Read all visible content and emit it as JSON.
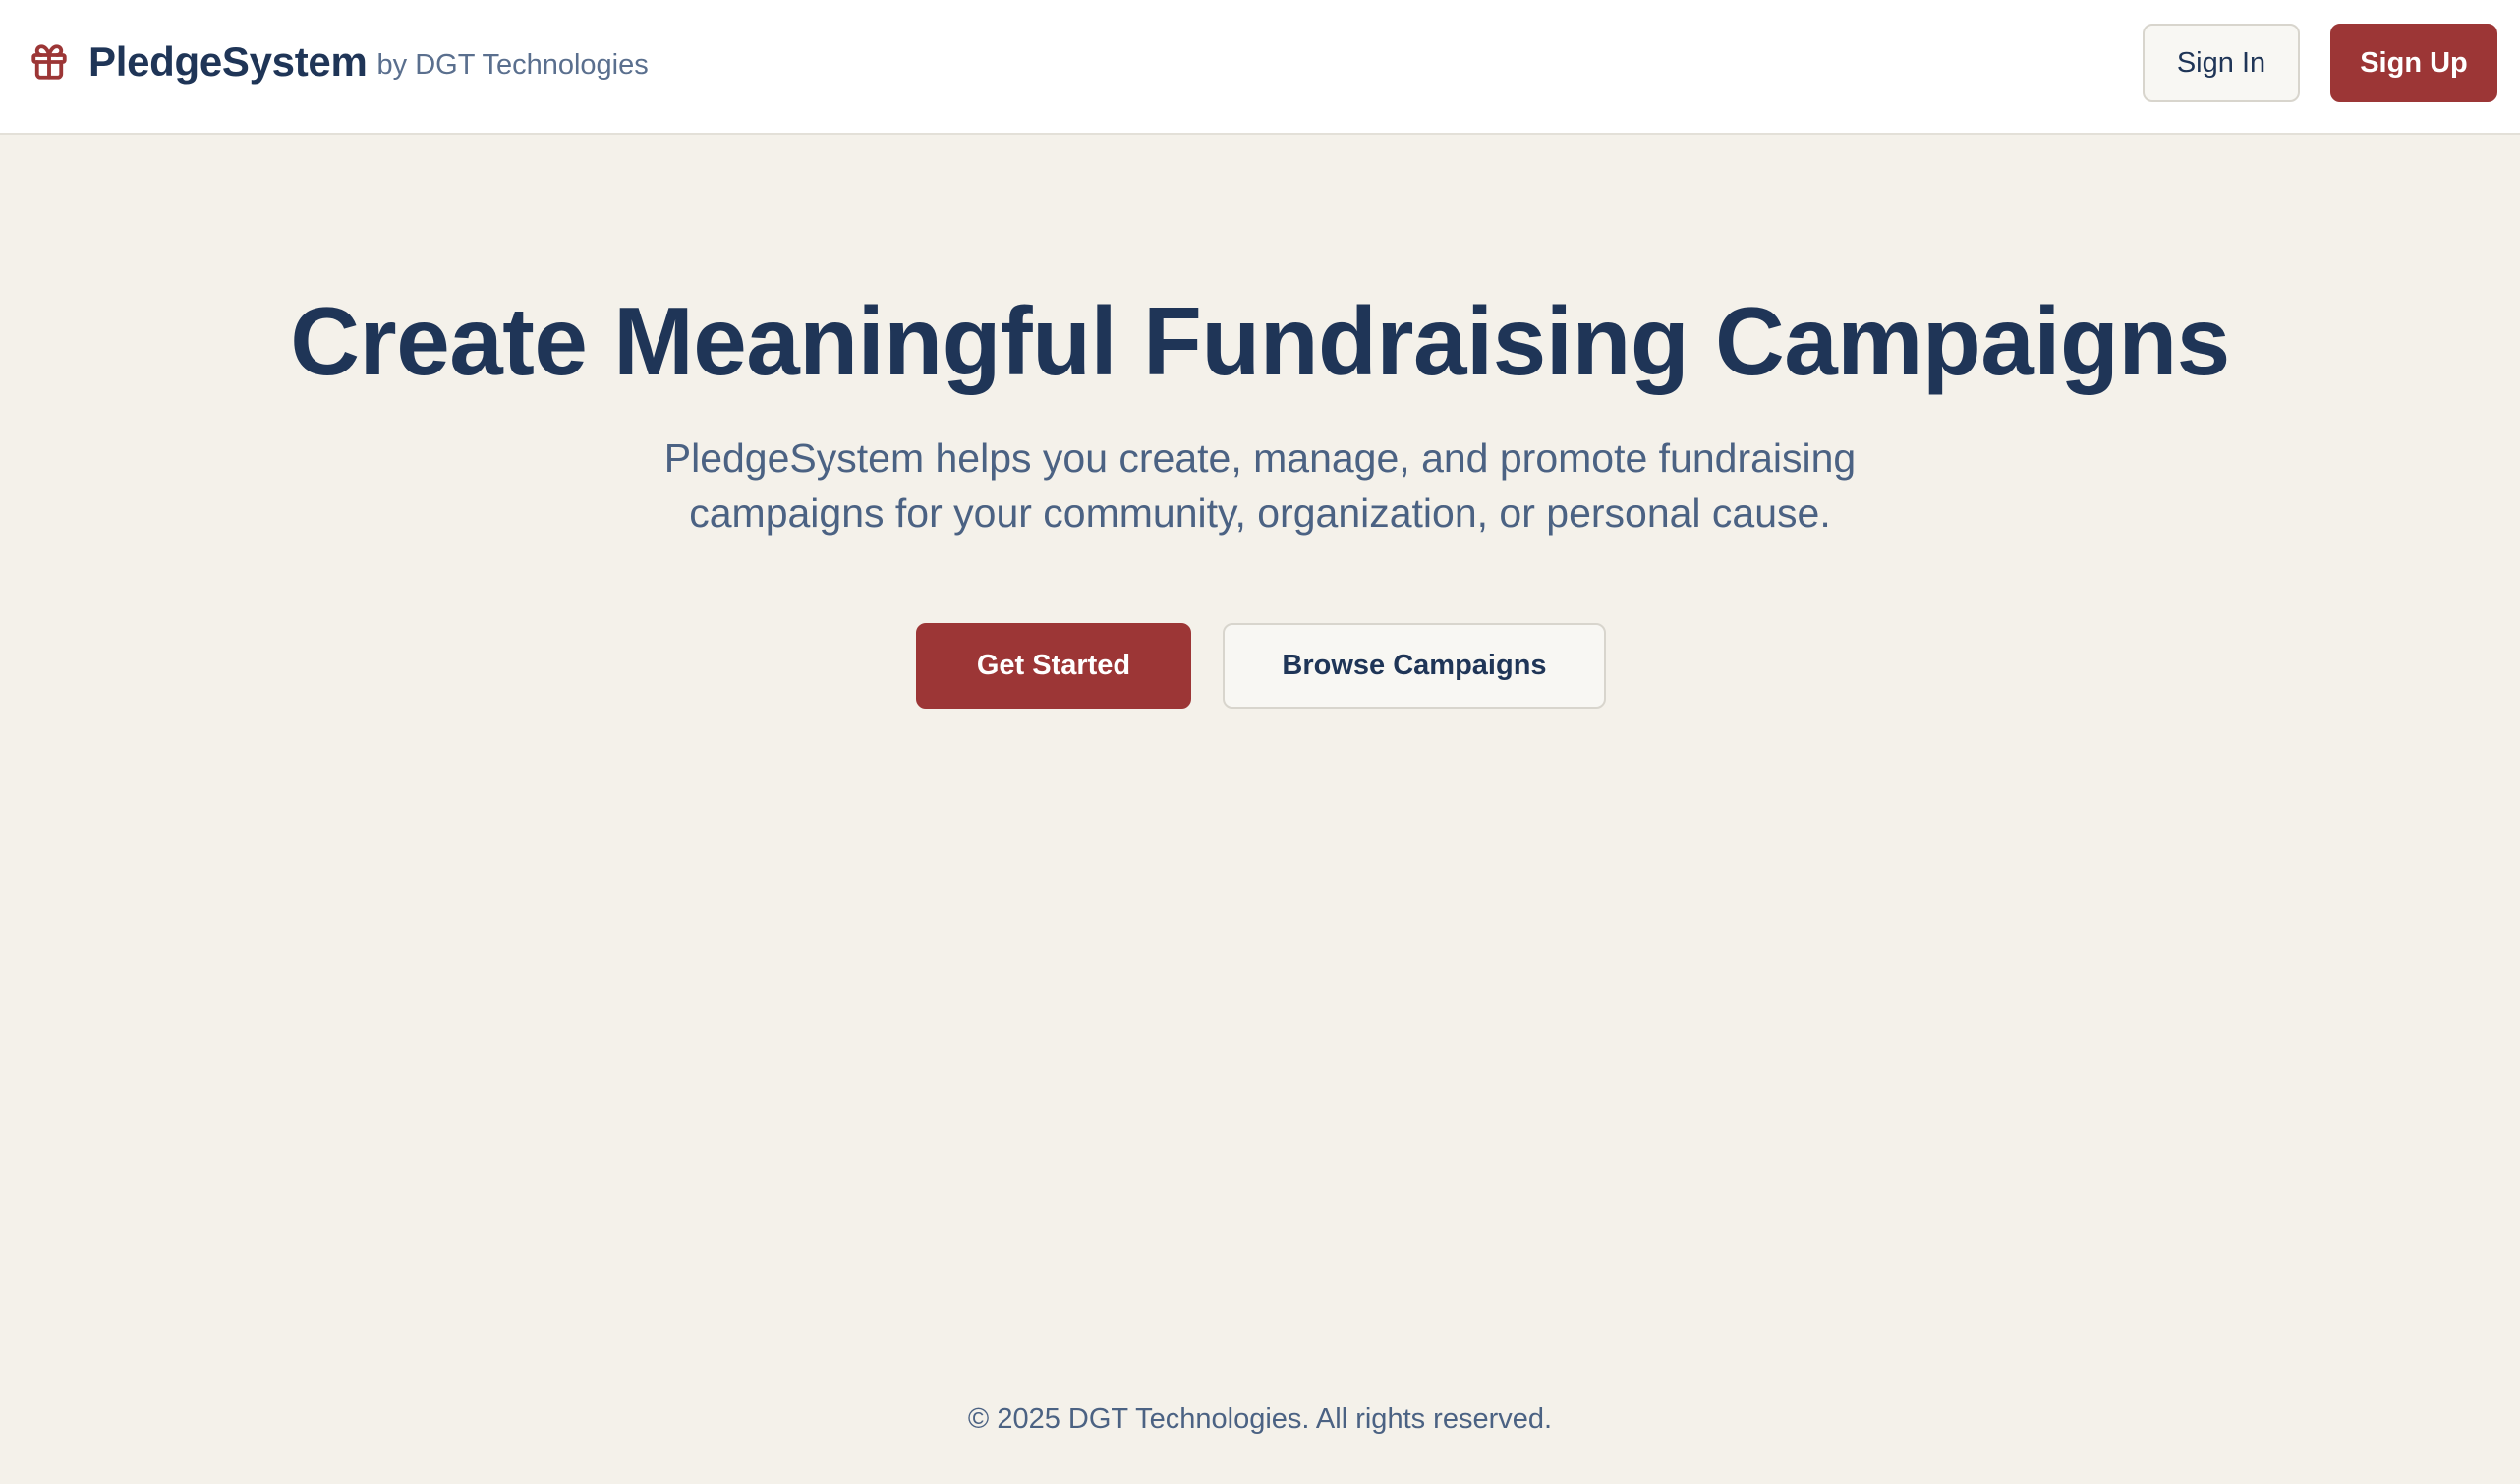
{
  "header": {
    "brand_name": "PledgeSystem",
    "brand_by": "by DGT Technologies",
    "brand_icon": "gift-icon",
    "sign_in_label": "Sign In",
    "sign_up_label": "Sign Up"
  },
  "hero": {
    "title": "Create Meaningful Fundraising Campaigns",
    "subtitle": "PledgeSystem helps you create, manage, and promote fundraising campaigns for your community, organization, or personal cause.",
    "primary_cta": "Get Started",
    "secondary_cta": "Browse Campaigns"
  },
  "footer": {
    "copyright": "© 2025 DGT Technologies. All rights reserved."
  },
  "colors": {
    "accent": "#9c3636",
    "navy": "#1f3557",
    "muted_text": "#4b6283",
    "page_background": "#f4f1ea",
    "header_background": "#ffffff"
  }
}
